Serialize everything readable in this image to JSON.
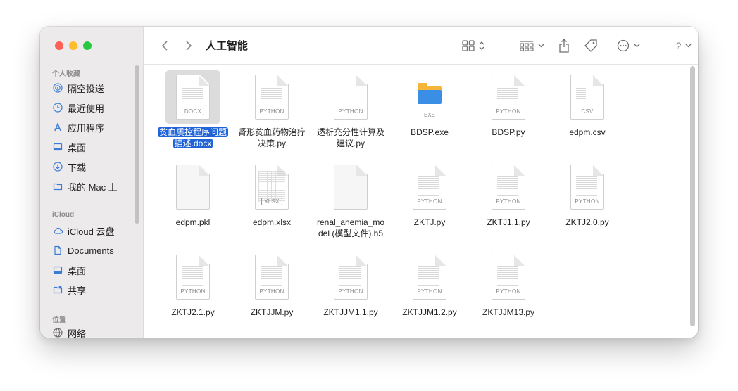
{
  "window": {
    "title": "人工智能"
  },
  "sidebar": {
    "sections": [
      {
        "header": "个人收藏",
        "items": [
          {
            "label": "隔空投送",
            "icon": "airdrop-icon"
          },
          {
            "label": "最近使用",
            "icon": "clock-icon"
          },
          {
            "label": "应用程序",
            "icon": "applications-icon"
          },
          {
            "label": "桌面",
            "icon": "desktop-icon"
          },
          {
            "label": "下载",
            "icon": "download-icon"
          },
          {
            "label": "我的 Mac 上",
            "icon": "folder-icon"
          }
        ]
      },
      {
        "header": "iCloud",
        "items": [
          {
            "label": "iCloud 云盘",
            "icon": "cloud-icon"
          },
          {
            "label": "Documents",
            "icon": "document-icon"
          },
          {
            "label": "桌面",
            "icon": "desktop-icon"
          },
          {
            "label": "共享",
            "icon": "shared-folder-icon"
          }
        ]
      },
      {
        "header": "位置",
        "items": [
          {
            "label": "网络",
            "icon": "network-icon"
          }
        ]
      }
    ]
  },
  "toolbar": {
    "view_mode": "icon-grid",
    "group_mode": "group-by",
    "help": "?"
  },
  "files": [
    {
      "name_line1": "贫血质控程序问题",
      "name_line2": "描述.docx",
      "type_badge": "DOCX",
      "selected": true
    },
    {
      "name_line1": "肾形贫血药物治疗",
      "name_line2": "决策.py",
      "type_badge": "PYTHON"
    },
    {
      "name_line1": "透析充分性计算及",
      "name_line2": "建议.py",
      "type_badge": "PYTHON"
    },
    {
      "name_line1": "BDSP.exe",
      "name_line2": "",
      "type_badge": "EXE"
    },
    {
      "name_line1": "BDSP.py",
      "name_line2": "",
      "type_badge": "PYTHON"
    },
    {
      "name_line1": "edpm.csv",
      "name_line2": "",
      "type_badge": "CSV"
    },
    {
      "name_line1": "edpm.pkl",
      "name_line2": "",
      "type_badge": ""
    },
    {
      "name_line1": "edpm.xlsx",
      "name_line2": "",
      "type_badge": "XLSX"
    },
    {
      "name_line1": "renal_anemia_mo",
      "name_line2": "del (模型文件).h5",
      "type_badge": ""
    },
    {
      "name_line1": "ZKTJ.py",
      "name_line2": "",
      "type_badge": "PYTHON"
    },
    {
      "name_line1": "ZKTJ1.1.py",
      "name_line2": "",
      "type_badge": "PYTHON"
    },
    {
      "name_line1": "ZKTJ2.0.py",
      "name_line2": "",
      "type_badge": "PYTHON"
    },
    {
      "name_line1": "ZKTJ2.1.py",
      "name_line2": "",
      "type_badge": "PYTHON"
    },
    {
      "name_line1": "ZKTJJM.py",
      "name_line2": "",
      "type_badge": "PYTHON"
    },
    {
      "name_line1": "ZKTJJM1.1.py",
      "name_line2": "",
      "type_badge": "PYTHON"
    },
    {
      "name_line1": "ZKTJJM1.2.py",
      "name_line2": "",
      "type_badge": "PYTHON"
    },
    {
      "name_line1": "ZKTJJM13.py",
      "name_line2": "",
      "type_badge": "PYTHON"
    }
  ],
  "colors": {
    "selection": "#1f63d6",
    "sidebar_bg": "#eceaeb",
    "close": "#fe5f57",
    "minimize": "#febc2e",
    "zoom": "#28c840"
  }
}
